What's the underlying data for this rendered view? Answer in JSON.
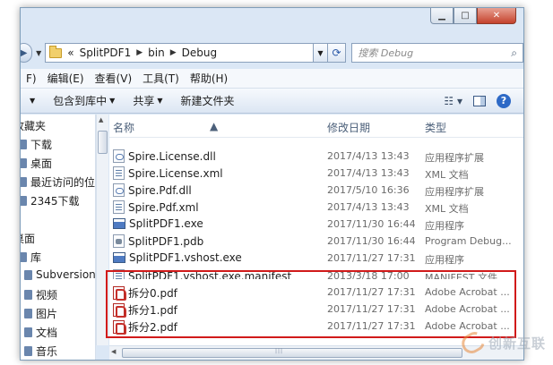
{
  "window": {
    "caption": {
      "minimize": "▁",
      "maximize": "□",
      "close": "✕"
    }
  },
  "address": {
    "prefix": "«",
    "crumbs": [
      "SplitPDF1",
      "bin",
      "Debug"
    ],
    "search_placeholder": "搜索 Debug"
  },
  "menu": [
    "F)",
    "编辑(E)",
    "查看(V)",
    "工具(T)",
    "帮助(H)"
  ],
  "toolbar": {
    "include_label": "包含到库中",
    "share_label": "共享",
    "new_folder_label": "新建文件夹"
  },
  "nav": [
    "收藏夹",
    "下载",
    "桌面",
    "最近访问的位置",
    "2345下载",
    "桌面",
    "库",
    "Subversion",
    "视频",
    "图片",
    "文档",
    "音乐"
  ],
  "columns": {
    "name": "名称",
    "date": "修改日期",
    "type": "类型"
  },
  "files": [
    {
      "name": "Spire.License.dll",
      "date": "2017/4/13 13:43",
      "type": "应用程序扩展",
      "icon": "cfg"
    },
    {
      "name": "Spire.License.xml",
      "date": "2017/4/13 13:43",
      "type": "XML 文档",
      "icon": "xml"
    },
    {
      "name": "Spire.Pdf.dll",
      "date": "2017/5/10 16:36",
      "type": "应用程序扩展",
      "icon": "cfg"
    },
    {
      "name": "Spire.Pdf.xml",
      "date": "2017/4/13 13:43",
      "type": "XML 文档",
      "icon": "xml"
    },
    {
      "name": "SplitPDF1.exe",
      "date": "2017/11/30 16:44",
      "type": "应用程序",
      "icon": "exe"
    },
    {
      "name": "SplitPDF1.pdb",
      "date": "2017/11/30 16:44",
      "type": "Program Debug...",
      "icon": "pdb"
    },
    {
      "name": "SplitPDF1.vshost.exe",
      "date": "2017/11/27 17:31",
      "type": "应用程序",
      "icon": "exe"
    },
    {
      "name": "SplitPDF1.vshost.exe.manifest",
      "date": "2013/3/18 17:00",
      "type": "MANIFEST 文件",
      "icon": "xml"
    },
    {
      "name": "拆分0.pdf",
      "date": "2017/11/27 17:31",
      "type": "Adobe Acrobat ...",
      "icon": "pdf"
    },
    {
      "name": "拆分1.pdf",
      "date": "2017/11/27 17:31",
      "type": "Adobe Acrobat ...",
      "icon": "pdf"
    },
    {
      "name": "拆分2.pdf",
      "date": "2017/11/27 17:31",
      "type": "Adobe Acrobat ...",
      "icon": "pdf"
    }
  ],
  "watermark": "创新互联",
  "colors": {
    "highlight": "#d11a1a",
    "window_frame": "#dbe7f5"
  }
}
